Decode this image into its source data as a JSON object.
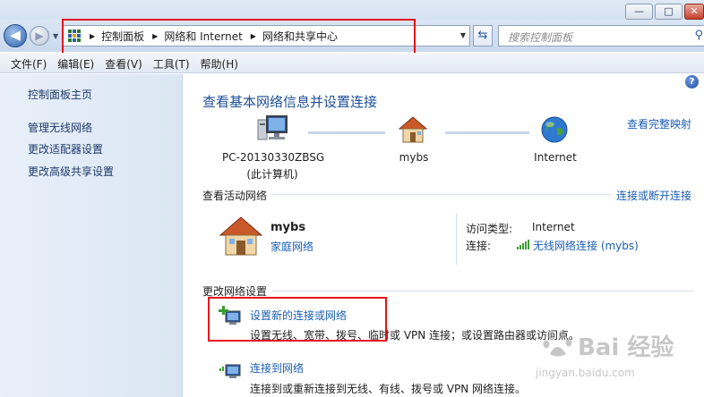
{
  "window": {
    "minimize_glyph": "—",
    "maximize_glyph": "□",
    "close_glyph": "✕"
  },
  "address_bar": {
    "breadcrumbs": [
      "控制面板",
      "网络和 Internet",
      "网络和共享中心"
    ],
    "search_placeholder": "搜索控制面板"
  },
  "menu": [
    "文件(F)",
    "编辑(E)",
    "查看(V)",
    "工具(T)",
    "帮助(H)"
  ],
  "sidebar": {
    "items": [
      "控制面板主页",
      "管理无线网络",
      "更改适配器设置",
      "更改高级共享设置"
    ]
  },
  "main": {
    "title": "查看基本网络信息并设置连接",
    "full_map_link": "查看完整映射",
    "network_map": {
      "computer_name": "PC-20130330ZBSG",
      "computer_sub": "(此计算机)",
      "network_name": "mybs",
      "internet_label": "Internet"
    },
    "active_networks": {
      "heading": "查看活动网络",
      "connect_link": "连接或断开连接",
      "name": "mybs",
      "type": "家庭网络",
      "access_type_label": "访问类型:",
      "access_type_value": "Internet",
      "connections_label": "连接:",
      "connections_value": "无线网络连接 (mybs)"
    },
    "change_settings": {
      "heading": "更改网络设置",
      "tasks": [
        {
          "title": "设置新的连接或网络",
          "desc": "设置无线、宽带、拨号、临时或 VPN 连接；或设置路由器或访问点。"
        },
        {
          "title": "连接到网络",
          "desc": "连接到或重新连接到无线、有线、拨号或 VPN 网络连接。"
        }
      ]
    }
  },
  "watermark": {
    "text": "Bai 经验",
    "url": "jingyan.baidu.com"
  },
  "colors": {
    "link": "#1a5fb4",
    "highlight_box": "#e3141c"
  }
}
